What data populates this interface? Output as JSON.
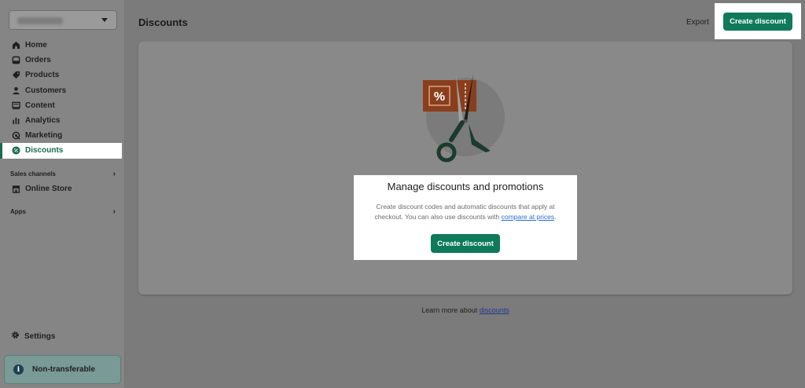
{
  "sidebar": {
    "store_name": "",
    "items": [
      {
        "label": "Home",
        "icon": "home-icon"
      },
      {
        "label": "Orders",
        "icon": "orders-icon"
      },
      {
        "label": "Products",
        "icon": "tag-icon"
      },
      {
        "label": "Customers",
        "icon": "person-icon"
      },
      {
        "label": "Content",
        "icon": "content-icon"
      },
      {
        "label": "Analytics",
        "icon": "analytics-icon"
      },
      {
        "label": "Marketing",
        "icon": "marketing-icon"
      },
      {
        "label": "Discounts",
        "icon": "discount-icon",
        "active": true
      }
    ],
    "sales_channels_label": "Sales channels",
    "online_store_label": "Online Store",
    "apps_label": "Apps",
    "settings_label": "Settings",
    "non_transferable_label": "Non-transferable"
  },
  "header": {
    "title": "Discounts",
    "export_label": "Export",
    "create_label": "Create discount"
  },
  "empty_state": {
    "title": "Manage discounts and promotions",
    "desc_prefix": "Create discount codes and automatic discounts that apply at checkout. You can also use discounts with ",
    "desc_link": "compare at prices",
    "desc_suffix": ".",
    "button_label": "Create discount"
  },
  "footer": {
    "learn_prefix": "Learn more about ",
    "learn_link": "discounts"
  },
  "colors": {
    "accent": "#0e7a5a",
    "active_nav": "#1a6b4e",
    "link": "#2c6ecb"
  }
}
